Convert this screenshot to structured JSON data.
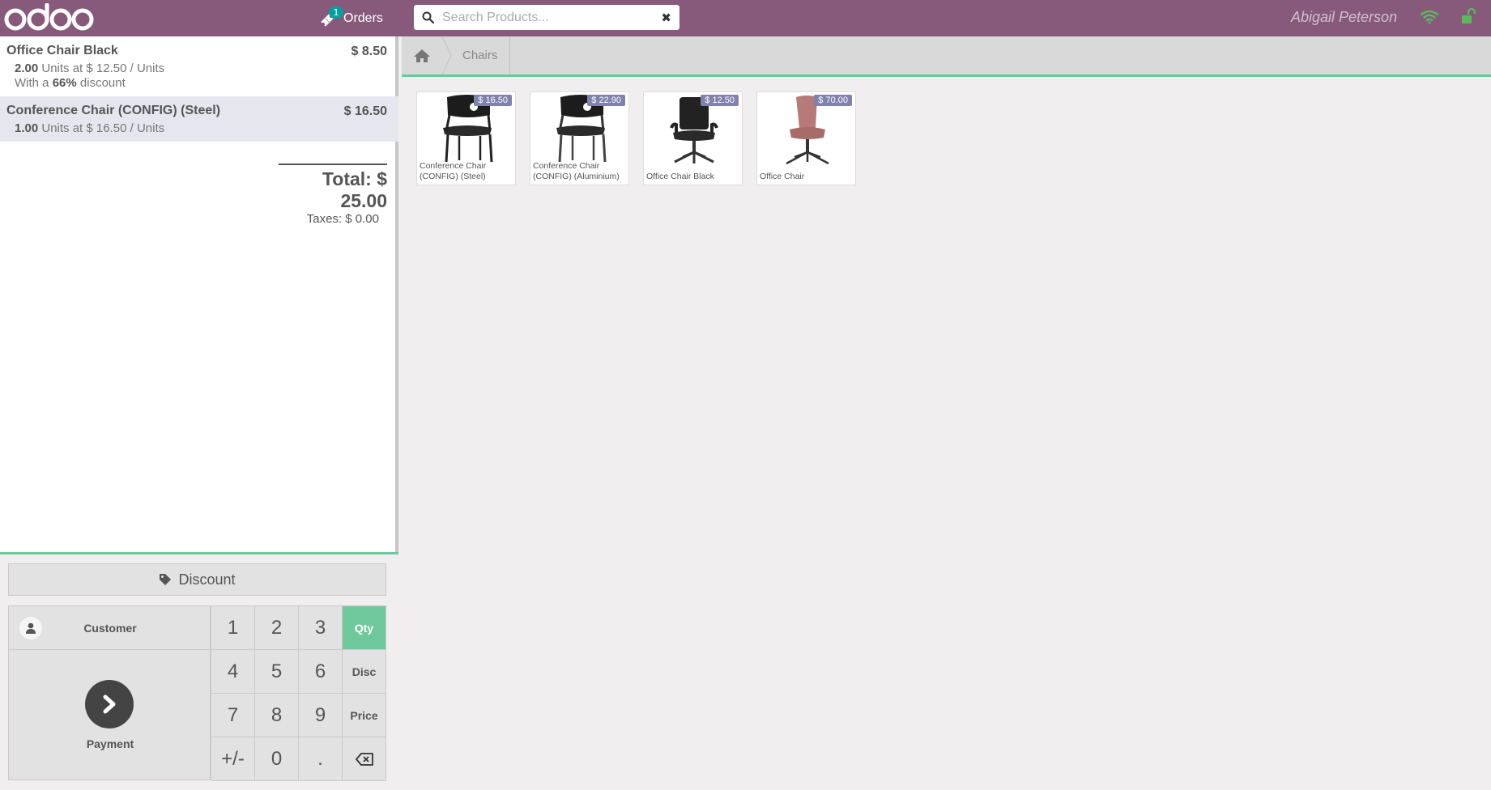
{
  "header": {
    "logo": "odoo",
    "orders_count": "1",
    "orders_label": "Orders",
    "search_placeholder": "Search Products...",
    "clear_icon": "✖",
    "user_name": "Abigail Peterson",
    "wifi_color": "#5cb85c",
    "lock_color": "#5cb85c"
  },
  "order": {
    "lines": [
      {
        "name": "Office Chair Black",
        "price": "$ 8.50",
        "qty": "2.00",
        "unit_text": "Units at $ 12.50 / Units",
        "discount_prefix": "With a",
        "discount_value": "66%",
        "discount_suffix": "discount"
      },
      {
        "name": "Conference Chair (CONFIG) (Steel)",
        "price": "$ 16.50",
        "qty": "1.00",
        "unit_text": "Units at $ 16.50 / Units"
      }
    ],
    "total": "Total: $ 25.00",
    "taxes": "Taxes: $ 0.00"
  },
  "control": {
    "discount_label": "Discount",
    "customer_label": "Customer",
    "payment_label": "Payment",
    "keys": [
      "1",
      "2",
      "3",
      "Qty",
      "4",
      "5",
      "6",
      "Disc",
      "7",
      "8",
      "9",
      "Price",
      "+/-",
      "0",
      ".",
      "⌫"
    ],
    "active_mode": "Qty",
    "accent_color": "#6ec89b"
  },
  "breadcrumb": {
    "category": "Chairs"
  },
  "products": [
    {
      "name": "Conference Chair (CONFIG) (Steel)",
      "price": "$ 16.50"
    },
    {
      "name": "Conference Chair (CONFIG) (Aluminium)",
      "price": "$ 22.90"
    },
    {
      "name": "Office Chair Black",
      "price": "$ 12.50"
    },
    {
      "name": "Office Chair",
      "price": "$ 70.00"
    }
  ],
  "colors": {
    "brand": "#875a7b",
    "price_tag": "#7f82ac"
  }
}
